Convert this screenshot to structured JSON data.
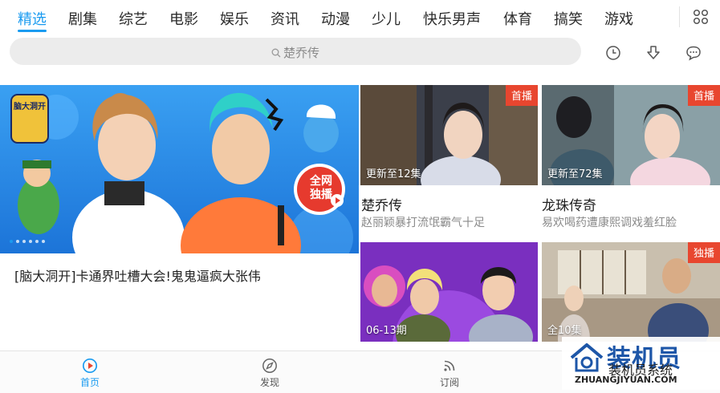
{
  "tabs": [
    {
      "label": "精选",
      "active": true
    },
    {
      "label": "剧集"
    },
    {
      "label": "综艺"
    },
    {
      "label": "电影"
    },
    {
      "label": "娱乐"
    },
    {
      "label": "资讯"
    },
    {
      "label": "动漫"
    },
    {
      "label": "少儿"
    },
    {
      "label": "快乐男声"
    },
    {
      "label": "体育"
    },
    {
      "label": "搞笑"
    },
    {
      "label": "游戏"
    }
  ],
  "icons": {
    "grid": "grid-menu-icon",
    "history": "history-clock-icon",
    "download": "download-icon",
    "message": "message-icon",
    "search": "search-icon"
  },
  "search": {
    "placeholder": "楚乔传"
  },
  "hero": {
    "caption": "[脑大洞开]卡通界吐槽大会!鬼鬼逼疯大张伟",
    "badge_line1": "全网",
    "badge_line2": "独播",
    "logo_text": "脑大洞开",
    "slide_count": 6,
    "active_slide": 1
  },
  "cards": [
    {
      "badge": "首播",
      "overlay": "更新至12集",
      "title": "楚乔传",
      "subtitle": "赵丽颖暴打流氓霸气十足"
    },
    {
      "badge": "首播",
      "overlay": "更新至72集",
      "title": "龙珠传奇",
      "subtitle": "易欢喝药遭康熙调戏羞红脸"
    },
    {
      "badge": "",
      "overlay": "06-13期",
      "title": "",
      "subtitle": ""
    },
    {
      "badge": "独播",
      "overlay": "全10集",
      "title": "",
      "subtitle": ""
    }
  ],
  "bottom_nav": [
    {
      "label": "首页",
      "icon": "play-circle-icon",
      "active": true
    },
    {
      "label": "发现",
      "icon": "compass-icon"
    },
    {
      "label": "订阅",
      "icon": "rss-icon"
    }
  ],
  "watermark": {
    "title": "装机员",
    "subtitle": "装机员系统",
    "url": "ZHUANGJIYUAN.COM"
  },
  "colors": {
    "accent": "#1a9bf0",
    "badge": "#e8462f",
    "watermark": "#1d56a8"
  }
}
